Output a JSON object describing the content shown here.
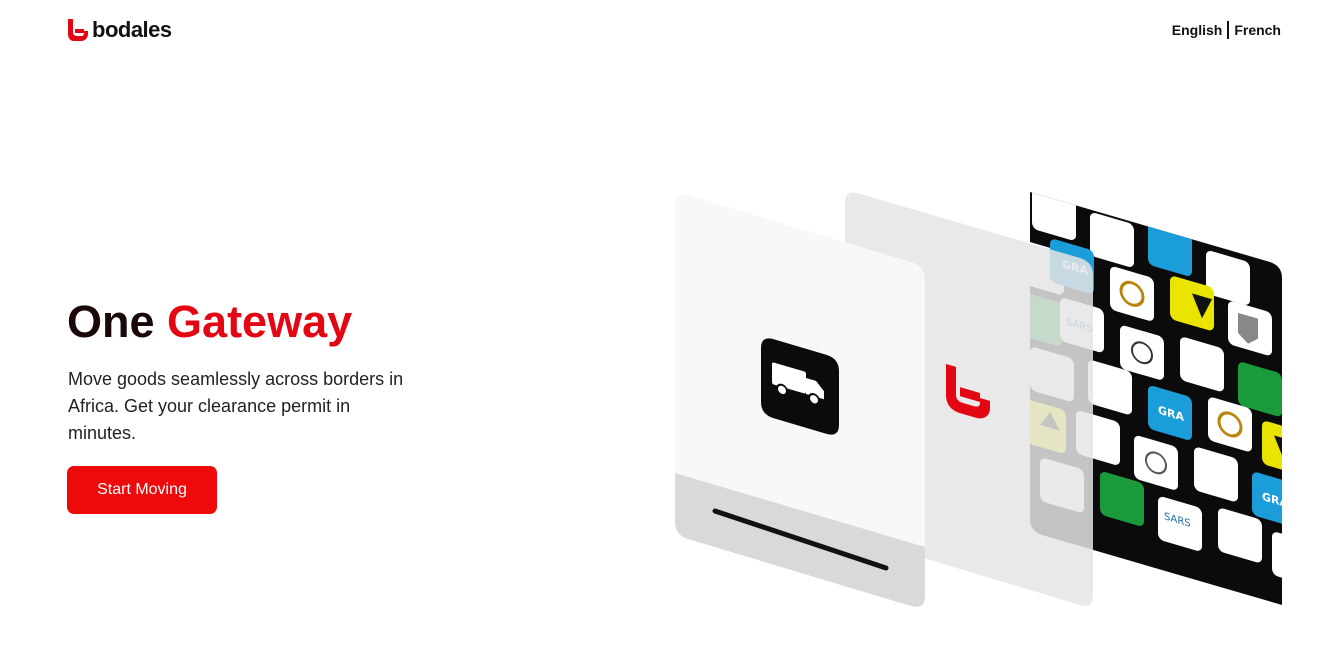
{
  "brand": {
    "name": "bodales",
    "color": "#e30613"
  },
  "header": {
    "languages": [
      "English",
      "French"
    ]
  },
  "hero": {
    "title_part1": "One",
    "title_part2": "Gateway",
    "subtitle": "Move goods seamlessly across borders in Africa. Get your clearance permit in minutes.",
    "cta_label": "Start Moving"
  },
  "illustration": {
    "cards": [
      "truck-card",
      "bodales-logo-card",
      "agency-logos-card"
    ],
    "agency_tile_labels": [
      "GRA",
      "SARS"
    ]
  }
}
